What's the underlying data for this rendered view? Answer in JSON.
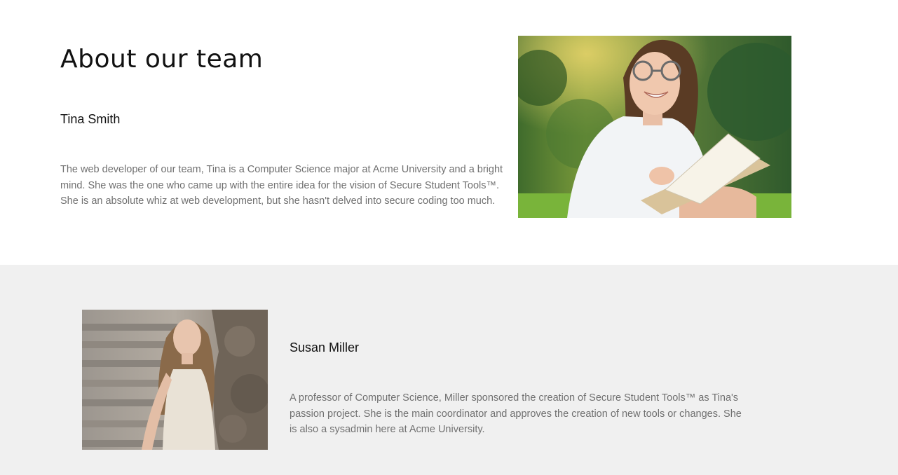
{
  "page": {
    "title": "About our team"
  },
  "members": [
    {
      "name": "Tina Smith",
      "bio": "The web developer of our team, Tina is a Computer Science major at Acme University and a bright mind. She was the one who came up with the entire idea for the vision of Secure Student Tools™. She is an absolute whiz at web development, but she hasn't delved into secure coding too much.",
      "photo": "photo-of-woman-with-glasses-reading-book"
    },
    {
      "name": "Susan Miller",
      "bio": "A professor of Computer Science, Miller sponsored the creation of Secure Student Tools™ as Tina's passion project. She is the main coordinator and approves the creation of new tools or changes. She is also a sysadmin here at Acme University.",
      "photo": "photo-of-woman-on-stone-steps"
    }
  ],
  "colors": {
    "section_top_bg": "#ffffff",
    "section_bottom_bg": "#f0f0f0",
    "heading_text": "#111111",
    "body_text": "#707070"
  }
}
